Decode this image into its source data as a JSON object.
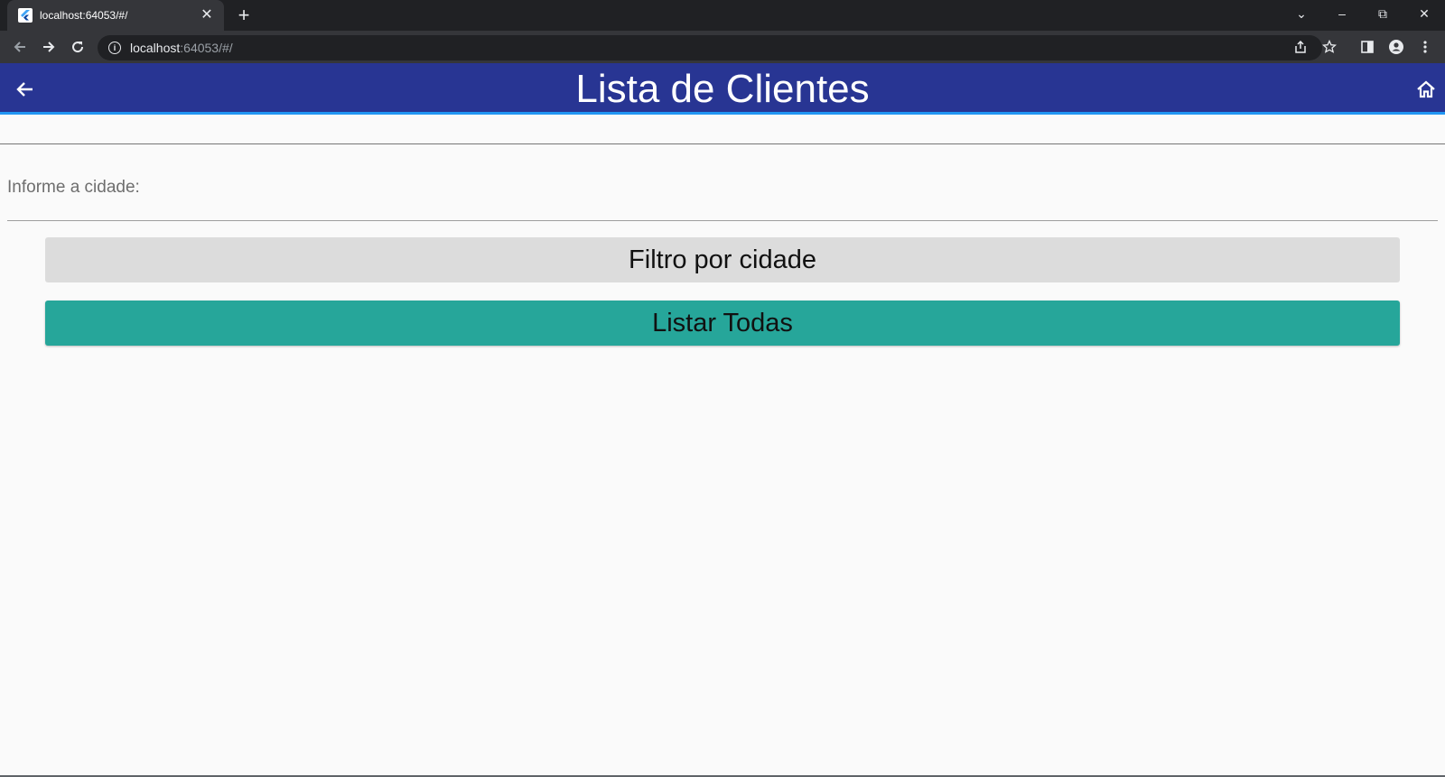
{
  "browser": {
    "tab_title": "localhost:64053/#/",
    "tab_close": "✕",
    "new_tab": "+",
    "url_host": "localhost",
    "url_rest": ":64053/#/",
    "win_dropdown": "⌄",
    "win_minimize": "–",
    "win_restore": "⧉",
    "win_close": "✕"
  },
  "appbar": {
    "title": "Lista de Clientes"
  },
  "form": {
    "city_label": "Informe a cidade:"
  },
  "buttons": {
    "filter_label": "Filtro por cidade",
    "list_all_label": "Listar Todas"
  },
  "colors": {
    "appbar": "#283593",
    "appbar_accent": "#2196f3",
    "filter_button": "#dcdcdc",
    "list_all_button": "#26a69a"
  }
}
